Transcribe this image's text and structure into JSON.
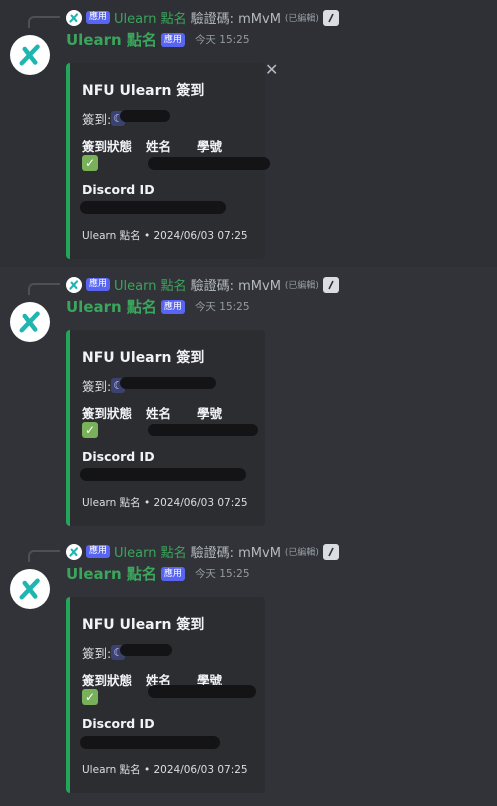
{
  "bot": {
    "name": "Ulearn 點名",
    "app_badge": "應用",
    "reply_text": "驗證碼: mMvM",
    "edited": "(已編輯)",
    "timestamp": "今天 15:25",
    "avatar_icon": "teal-x-logo-icon",
    "command_icon": "slash-command-icon"
  },
  "messages": [
    {
      "embed": {
        "title": "NFU Ulearn 簽到",
        "desc_label": "簽到:",
        "field_status": "簽到狀態",
        "field_name": "姓名",
        "field_id": "學號",
        "status_icon": "white-check-mark-icon",
        "discord_label": "Discord ID",
        "footer": "Ulearn 點名 • 2024/06/03 07:25"
      },
      "has_close": true
    },
    {
      "embed": {
        "title": "NFU Ulearn 簽到",
        "desc_label": "簽到:",
        "field_status": "簽到狀態",
        "field_name": "姓名",
        "field_id": "學號",
        "status_icon": "white-check-mark-icon",
        "discord_label": "Discord ID",
        "footer": "Ulearn 點名 • 2024/06/03 07:25"
      }
    },
    {
      "embed": {
        "title": "NFU Ulearn 簽到",
        "desc_label": "簽到:",
        "field_status": "簽到狀態",
        "field_name": "姓名",
        "field_id": "學號",
        "status_icon": "white-check-mark-icon",
        "discord_label": "Discord ID",
        "footer": "Ulearn 點名 • 2024/06/03 07:25"
      }
    }
  ],
  "colors": {
    "background": "#313338",
    "embed_bg": "#2b2d31",
    "embed_accent": "#23a55a",
    "username": "#3ba55c",
    "badge": "#5865f2"
  }
}
